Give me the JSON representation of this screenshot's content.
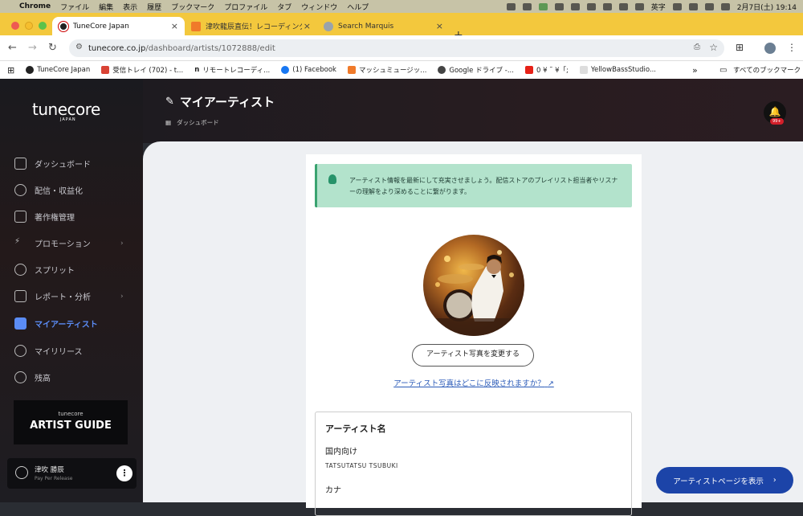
{
  "menubar": {
    "app": "Chrome",
    "items": [
      "ファイル",
      "編集",
      "表示",
      "履歴",
      "ブックマーク",
      "プロファイル",
      "タブ",
      "ウィンドウ",
      "ヘルプ"
    ],
    "input_mode": "英字",
    "clock": "2月7日(土) 19:14"
  },
  "tabs": [
    {
      "title": "TuneCore Japan",
      "active": true
    },
    {
      "title": "津吹龍辰直伝！レコーディング&",
      "active": false
    },
    {
      "title": "Search Marquis",
      "active": false
    }
  ],
  "address": {
    "host": "tunecore.co.jp",
    "path": "/dashboard/artists/1072888/edit"
  },
  "bookmarks": [
    "TuneCore Japan",
    "受信トレイ (702) - t...",
    "リモートレコーディ...",
    "(1) Facebook",
    "マッシュミュージッ...",
    "Google ドライブ -...",
    "0 ¥ ˜ ¥「;",
    "YellowBassStudio..."
  ],
  "bookmarks_all": "すべてのブックマーク",
  "sidebar": {
    "logo": "tunecore",
    "logo_sub": "JAPAN",
    "items": [
      {
        "label": "ダッシュボード"
      },
      {
        "label": "配信・収益化"
      },
      {
        "label": "著作権管理"
      },
      {
        "label": "プロモーション"
      },
      {
        "label": "スプリット"
      },
      {
        "label": "レポート・分析"
      },
      {
        "label": "マイアーティスト"
      },
      {
        "label": "マイリリース"
      },
      {
        "label": "残高"
      }
    ],
    "guide": {
      "brand": "tunecore",
      "title": "ARTIST GUIDE"
    },
    "user": {
      "name": "津吹 勝辰",
      "plan": "Pay Per Release"
    }
  },
  "header": {
    "title": "マイアーティスト",
    "breadcrumb": "ダッシュボード",
    "notification_badge": "99+"
  },
  "main": {
    "info": "アーティスト情報を最新にして充実させましょう。配信ストアのプレイリスト担当者やリスナーの理解をより深めることに繋がります。",
    "change_photo": "アーティスト写真を変更する",
    "photo_link": "アーティスト写真はどこに反映されますか？",
    "form": {
      "heading": "アーティスト名",
      "domestic_label": "国内向け",
      "domestic_value": "TATSUTATSU TSUBUKI",
      "kana_label": "カナ"
    }
  },
  "cta": {
    "label": "アーティストページを表示"
  },
  "colors": {
    "accent": "#1c44a8",
    "active_nav": "#5b8cf5",
    "info_bg": "#b3e3cc"
  }
}
